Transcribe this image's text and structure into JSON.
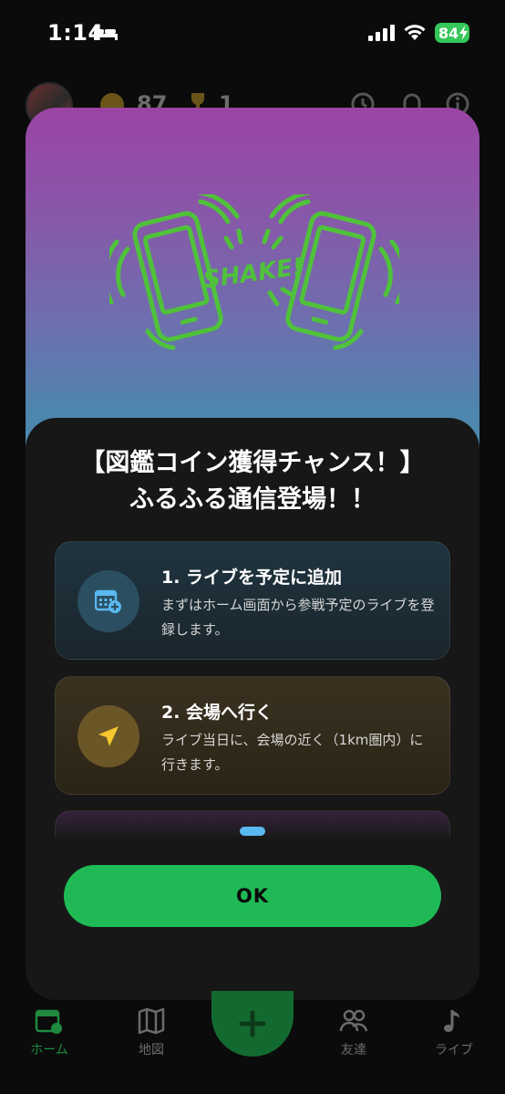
{
  "status_bar": {
    "time": "1:14",
    "battery": "84"
  },
  "header": {
    "coins": "87",
    "trophies": "1"
  },
  "modal": {
    "shake_text": "SHAKE!",
    "title_line1": "【図鑑コイン獲得チャンス！】",
    "title_line2": "ふるふる通信登場！！",
    "steps": [
      {
        "title": "1. ライブを予定に追加",
        "description": "まずはホーム画面から参戦予定のライブを登録します。",
        "icon": "calendar-add-icon"
      },
      {
        "title": "2. 会場へ行く",
        "description": "ライブ当日に、会場の近く（1km圏内）に行きます。",
        "icon": "location-arrow-icon"
      }
    ],
    "ok_label": "OK"
  },
  "tabbar": {
    "items": [
      {
        "label": "ホーム",
        "icon": "home-calendar-icon"
      },
      {
        "label": "地図",
        "icon": "map-icon"
      },
      {
        "label": "友達",
        "icon": "friends-icon"
      },
      {
        "label": "ライブ",
        "icon": "music-note-icon"
      }
    ],
    "fab_icon": "plus-icon"
  },
  "colors": {
    "accent_green": "#1fba55",
    "hero_top": "#9b44a4",
    "hero_bottom": "#4f8aae",
    "page_dot": "#5ab8f0",
    "shake_green": "#4fc23a"
  }
}
